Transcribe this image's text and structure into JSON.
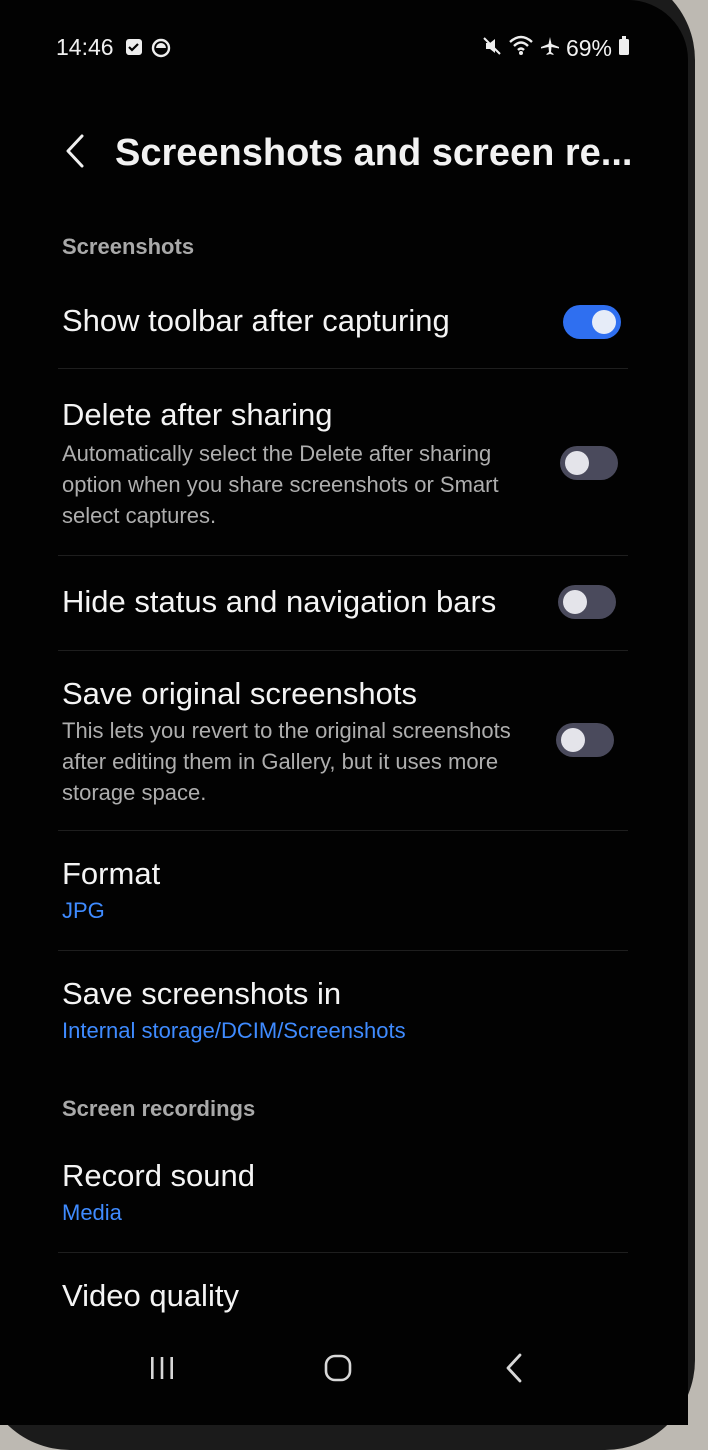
{
  "status_bar": {
    "time": "14:46",
    "battery": "69%",
    "icons": [
      "calendar-check-icon",
      "app-status-icon",
      "mute-icon",
      "wifi-icon",
      "airplane-icon",
      "battery-icon"
    ]
  },
  "header": {
    "title": "Screenshots and screen re..."
  },
  "sections": {
    "screenshots": "Screenshots",
    "screen_recordings": "Screen recordings"
  },
  "settings": {
    "show_toolbar": {
      "title": "Show toolbar after capturing",
      "enabled": true
    },
    "delete_after_sharing": {
      "title": "Delete after sharing",
      "description": "Automatically select the Delete after sharing option when you share screenshots or Smart select captures.",
      "enabled": false
    },
    "hide_bars": {
      "title": "Hide status and navigation bars",
      "enabled": false
    },
    "save_original": {
      "title": "Save original screenshots",
      "description": "This lets you revert to the original screenshots after editing them in Gallery, but it uses more storage space.",
      "enabled": false
    },
    "format": {
      "title": "Format",
      "value": "JPG"
    },
    "save_location": {
      "title": "Save screenshots in",
      "value": "Internal storage/DCIM/Screenshots"
    },
    "record_sound": {
      "title": "Record sound",
      "value": "Media"
    },
    "video_quality": {
      "title": "Video quality"
    }
  },
  "colors": {
    "accent": "#3f8bff",
    "toggle_on": "#2f6ff0",
    "toggle_off": "#4a4a5c",
    "background": "#020202"
  },
  "navigation": {
    "icons": [
      "recent-apps-icon",
      "home-icon",
      "back-icon"
    ]
  }
}
